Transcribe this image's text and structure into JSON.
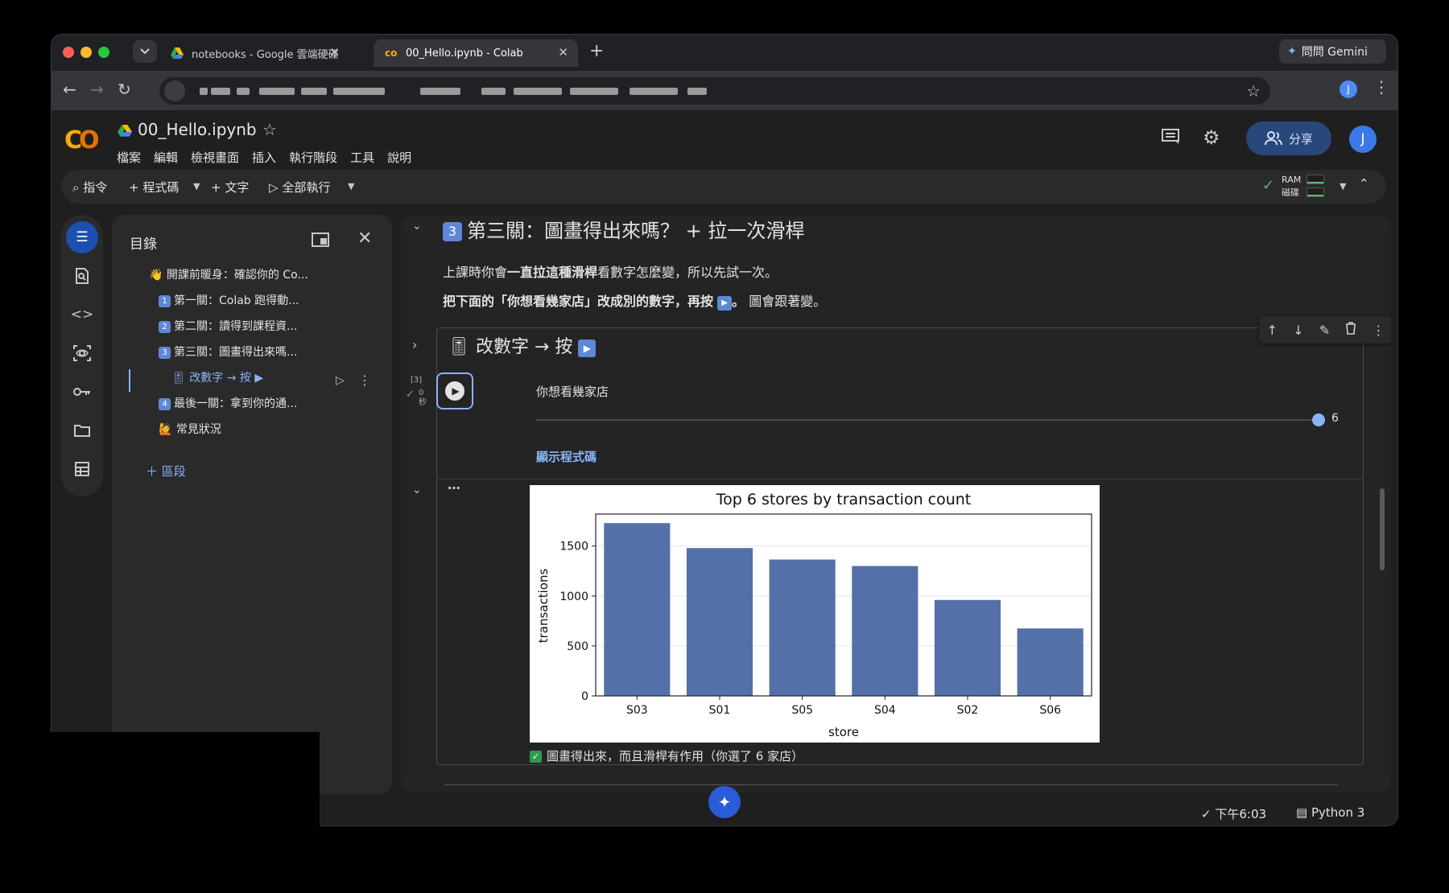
{
  "browser": {
    "tabs": [
      {
        "title": "notebooks - Google 雲端硬碟",
        "active": false
      },
      {
        "title": "00_Hello.ipynb - Colab",
        "active": true
      }
    ],
    "gemini_label": "問問 Gemini",
    "profile_initial": "J"
  },
  "colab": {
    "notebook_title": "00_Hello.ipynb",
    "menu": [
      "檔案",
      "編輯",
      "檢視畫面",
      "插入",
      "執行階段",
      "工具",
      "說明"
    ],
    "share_label": "分享",
    "avatar_initial": "J",
    "toolbar": {
      "commands": "指令",
      "add_code": "+ 程式碼",
      "add_text": "+ 文字",
      "run_all": "全部執行",
      "ram": "RAM",
      "disk": "磁碟",
      "ram_usage": 0.25,
      "disk_usage": 0.2
    },
    "toc": {
      "title": "目錄",
      "items": [
        {
          "num": "",
          "prefix": "👋 ",
          "label": "開課前暖身：確認你的 Co..."
        },
        {
          "num": "1",
          "prefix": "",
          "label": "第一關：Colab 跑得動..."
        },
        {
          "num": "2",
          "prefix": "",
          "label": "第二關：讀得到課程資..."
        },
        {
          "num": "3",
          "prefix": "",
          "label": "第三關：圖畫得出來嗎..."
        },
        {
          "num": "",
          "prefix": "🎚 ",
          "label": "改數字 → 按 ▶"
        },
        {
          "num": "4",
          "prefix": "",
          "label": "最後一關：拿到你的通..."
        },
        {
          "num": "",
          "prefix": "🙋 ",
          "label": "常見狀況"
        }
      ],
      "add_section": "區段"
    },
    "section": {
      "badge": "3",
      "heading": "第三關：圖畫得出來嗎？ + 拉一次滑桿",
      "line1_a": "上課時你會",
      "line1_b": "一直拉這種滑桿",
      "line1_c": "看數字怎麼變，所以先試一次。",
      "line2_a": "把下面的「你想看幾家店」改成別的數字，再按",
      "line2_b": "。",
      "line2_c": " 圖會跟著變。"
    },
    "cell": {
      "form_title": "改數字 → 按",
      "exec_count": "[3]",
      "exec_time": "0\n秒",
      "slider_label": "你想看幾家店",
      "slider_value": "6",
      "slider_fraction": 1.0,
      "show_code": "顯示程式碼",
      "status_text": "圖畫得出來，而且滑桿有作用（你選了 6 家店）"
    },
    "footer": {
      "time": "下午6:03",
      "runtime": "Python 3"
    }
  },
  "chart_data": {
    "type": "bar",
    "title": "Top 6 stores by transaction count",
    "xlabel": "store",
    "ylabel": "transactions",
    "categories": [
      "S03",
      "S01",
      "S05",
      "S04",
      "S02",
      "S06"
    ],
    "values": [
      1730,
      1480,
      1365,
      1300,
      960,
      675
    ],
    "ylim": [
      0,
      1820
    ],
    "yticks": [
      0,
      500,
      1000,
      1500
    ],
    "color": "#5470a9"
  }
}
